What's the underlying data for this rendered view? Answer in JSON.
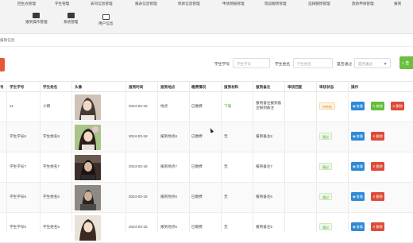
{
  "nav": {
    "row1": [
      "回生办管理",
      "学生管理",
      "表司信息管理",
      "报表信息管理",
      "债款信息管理",
      "申请债报管理",
      "现说服债管理",
      "选择服债管理",
      "放款申请管理",
      "报到"
    ],
    "row2": [
      "报到操作管理",
      "系统管理",
      "用户信息"
    ]
  },
  "breadcrumb": "报到信息",
  "filters": {
    "student_no_label": "学生学号",
    "student_no_placeholder": "学生学号",
    "student_name_label": "学生姓名",
    "student_name_placeholder": "学生姓名",
    "passed_label": "是否通过",
    "passed_value": "是否通过",
    "search_label": "查"
  },
  "table": {
    "headers": [
      "号",
      "学生学号",
      "学生姓名",
      "头像",
      "报到时间",
      "报到地点",
      "缴费情况",
      "报到材料",
      "报到备注",
      "审核回复",
      "审核状态",
      "操作"
    ],
    "rows": [
      {
        "no": "",
        "student_no": "11",
        "student_name": "小雨",
        "date": "2024-03-18",
        "place": "地点",
        "payment": "已缴费",
        "material": "下载",
        "remark": "报到备注报到备\n注报到备注",
        "reply": "",
        "status": "待审核",
        "status_type": "pending",
        "actions": [
          "查看",
          "修改",
          "删除"
        ]
      },
      {
        "no": "",
        "student_no": "学生学号8",
        "student_name": "学生姓名8",
        "date": "2024-03-18",
        "place": "报到地点8",
        "payment": "已缴费",
        "material": "无",
        "remark": "报到备注8",
        "reply": "",
        "status": "通过",
        "status_type": "passed",
        "actions": [
          "查看",
          "删除"
        ]
      },
      {
        "no": "",
        "student_no": "学生学号7",
        "student_name": "学生姓名7",
        "date": "2024-03-18",
        "place": "报到地点7",
        "payment": "已缴费",
        "material": "无",
        "remark": "报到备注7",
        "reply": "",
        "status": "通过",
        "status_type": "passed",
        "actions": [
          "查看",
          "删除"
        ]
      },
      {
        "no": "",
        "student_no": "学生学号6",
        "student_name": "学生姓名6",
        "date": "2024-03-18",
        "place": "报到地点6",
        "payment": "已缴费",
        "material": "无",
        "remark": "报到备注6",
        "reply": "",
        "status": "通过",
        "status_type": "passed",
        "actions": [
          "查看",
          "删除"
        ]
      },
      {
        "no": "",
        "student_no": "学生学号5",
        "student_name": "学生姓名5",
        "date": "2024-03-18",
        "place": "报到地点5",
        "payment": "已缴费",
        "material": "无",
        "remark": "报到备注5",
        "reply": "",
        "status": "通过",
        "status_type": "passed",
        "actions": [
          "查看",
          "删除"
        ]
      }
    ]
  },
  "colors": {
    "primary": "#2f8ad6",
    "success": "#67bd3d",
    "danger": "#dd4b39",
    "warning": "#e0952b",
    "filter_search": "#6cbf3f"
  }
}
